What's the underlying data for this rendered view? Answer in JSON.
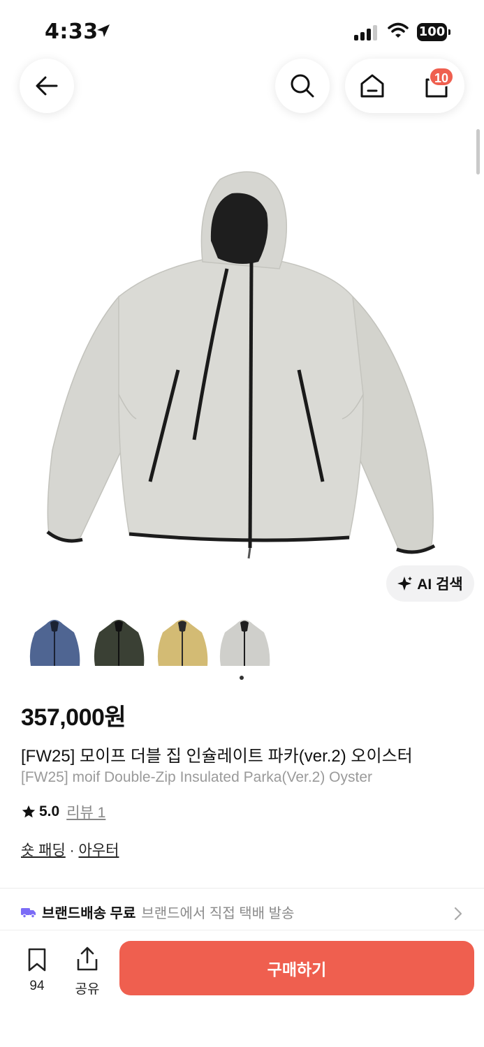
{
  "status_bar": {
    "time": "4:33",
    "battery": "100"
  },
  "nav": {
    "back_icon": "arrow-left-icon",
    "search_icon": "search-icon",
    "home_icon": "home-icon",
    "cart_icon": "shopping-bag-icon",
    "cart_count": "10"
  },
  "product": {
    "image_alt_icon": "parka-jacket-image",
    "ai_search_label": "AI 검색",
    "thumbnails": [
      {
        "name": "navy",
        "color": "#4f6592"
      },
      {
        "name": "dark-olive",
        "color": "#3a4034"
      },
      {
        "name": "mustard",
        "color": "#d3bb74"
      },
      {
        "name": "oyster",
        "color": "#cfcfcb"
      }
    ],
    "price": "357,000원",
    "title_ko": "[FW25] 모이프 더블 집 인슐레이트 파카(ver.2) 오이스터",
    "title_en": "[FW25] moif Double-Zip Insulated Parka(Ver.2) Oyster",
    "rating": "5.0",
    "review_label": "리뷰 1",
    "category_1": "숏 패딩",
    "category_sep": " · ",
    "category_2": "아우터"
  },
  "shipping": {
    "label": "브랜드배송 무료",
    "detail": "브랜드에서 직접 택배 발송"
  },
  "bottom_bar": {
    "bookmark_count": "94",
    "share_label": "공유",
    "buy_label": "구매하기"
  },
  "colors": {
    "accent": "#ef5f4f",
    "truck": "#7b6cf6"
  }
}
